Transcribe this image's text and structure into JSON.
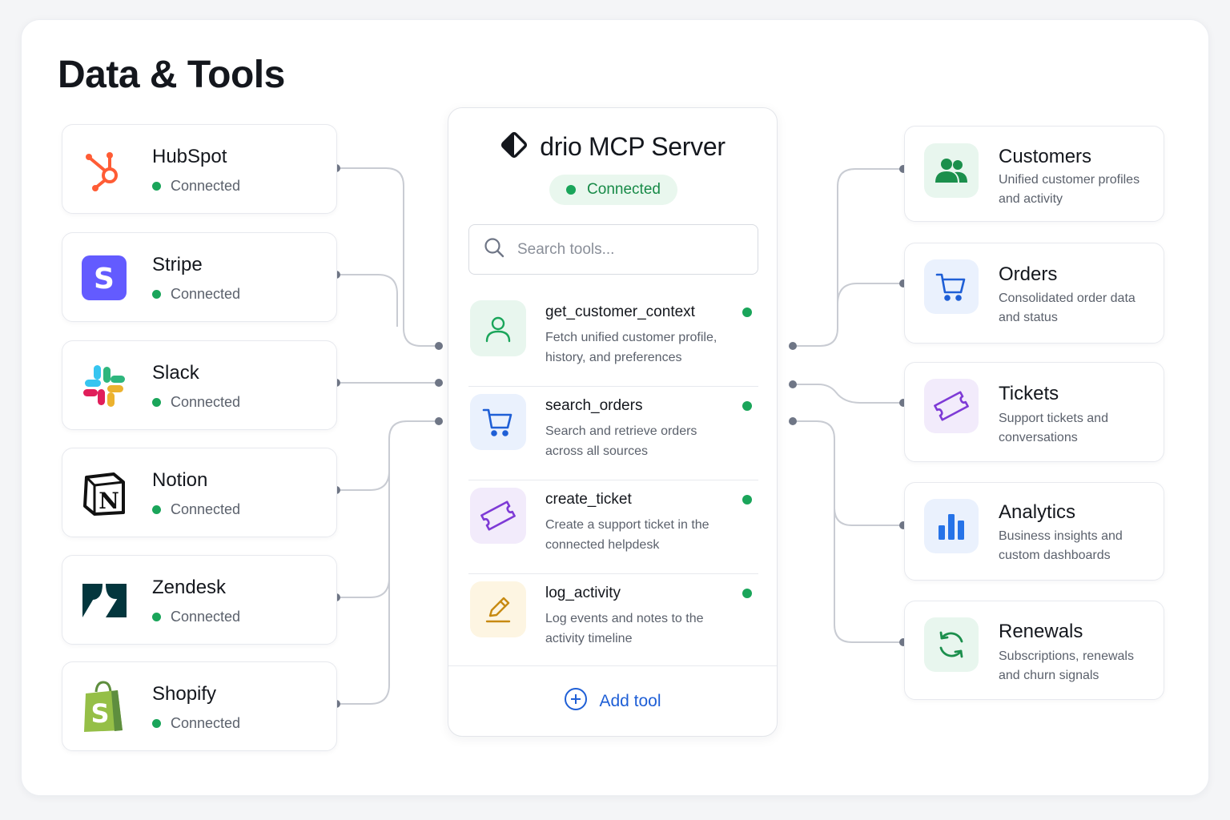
{
  "page": {
    "title": "Data & Tools"
  },
  "sources": [
    {
      "name": "HubSpot",
      "status": "Connected",
      "icon": "hubspot-icon"
    },
    {
      "name": "Stripe",
      "status": "Connected",
      "icon": "stripe-icon"
    },
    {
      "name": "Slack",
      "status": "Connected",
      "icon": "slack-icon"
    },
    {
      "name": "Notion",
      "status": "Connected",
      "icon": "notion-icon"
    },
    {
      "name": "Zendesk",
      "status": "Connected",
      "icon": "zendesk-icon"
    },
    {
      "name": "Shopify",
      "status": "Connected",
      "icon": "shopify-icon"
    }
  ],
  "server": {
    "title": "drio MCP Server",
    "status": "Connected",
    "search_placeholder": "Search tools...",
    "tools": [
      {
        "name": "get_customer_context",
        "description": "Fetch unified customer profile, history, and preferences",
        "icon": "user-icon"
      },
      {
        "name": "search_orders",
        "description": "Search and retrieve orders across all sources",
        "icon": "cart-icon"
      },
      {
        "name": "create_ticket",
        "description": "Create a support ticket in the connected helpdesk",
        "icon": "ticket-icon"
      },
      {
        "name": "log_activity",
        "description": "Log events and notes to the activity timeline",
        "icon": "pencil-icon"
      }
    ],
    "add_tool_label": "Add tool"
  },
  "destinations": [
    {
      "name": "Customers",
      "description": "Unified customer profiles and activity",
      "icon": "users-icon"
    },
    {
      "name": "Orders",
      "description": "Consolidated order data and status",
      "icon": "cart-icon"
    },
    {
      "name": "Tickets",
      "description": "Support tickets and conversations",
      "icon": "ticket-icon"
    },
    {
      "name": "Analytics",
      "description": "Business insights and custom dashboards",
      "icon": "bar-chart-icon"
    },
    {
      "name": "Renewals",
      "description": "Subscriptions, renewals and churn signals",
      "icon": "refresh-icon"
    }
  ],
  "colors": {
    "status_green": "#1aa55a",
    "accent_blue": "#1f5fd6",
    "connector": "#c9ccd3",
    "connector_dot": "#6f7686"
  }
}
